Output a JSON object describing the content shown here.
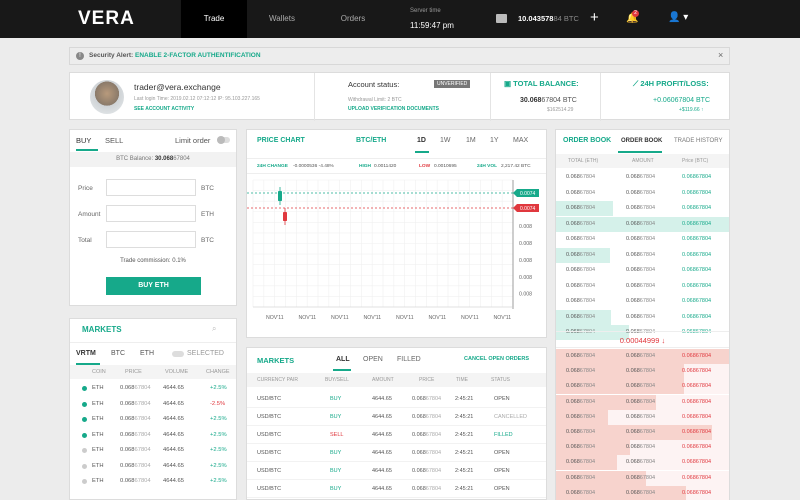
{
  "nav": {
    "logo": "VERA",
    "tabs": [
      "Trade",
      "Wallets",
      "Orders"
    ],
    "server_time_label": "Server time",
    "server_time": "11:59:47 pm",
    "balance_main": "10.043578",
    "balance_dim": "84 BTC",
    "notification_count": "2",
    "plus_glyph": "+"
  },
  "alert": {
    "label": "Security Alert:",
    "link": "ENABLE 2-FACTOR AUTHENTIFICATION",
    "close": "×"
  },
  "account": {
    "email": "trader@vera.exchange",
    "last_login": "Last login Time: 2019.02.12 07:12:12     IP: 95.103.227.165",
    "see_activity": "SEE ACCOUNT ACTIVITY",
    "status_label": "Account status:",
    "status_badge": "UNVERIFIED",
    "withdrawal": "Withdrawal Limit:   2 BTC",
    "upload": "UPLOAD VERIFICATION DOCUMENTS",
    "total_label": "TOTAL BALANCE:",
    "total_value": "30.068",
    "total_value_dim": "67804 BTC",
    "total_usd": "$162514.29",
    "pl_label": "24H PROFIT/LOSS:",
    "pl_value": "+0.06067804 BTC",
    "pl_usd": "+$119.66 ↑"
  },
  "buy_panel": {
    "tab_buy": "BUY",
    "tab_sell": "SELL",
    "limit_order": "Limit order",
    "balance_label": "BTC Balance:",
    "balance_value": "30.068",
    "balance_dim": "67804",
    "price_label": "Price",
    "price_unit": "BTC",
    "amount_label": "Amount",
    "amount_unit": "ETH",
    "total_label": "Total",
    "total_unit": "BTC",
    "commission": "Trade commission: 0.1%",
    "buy_button": "BUY ETH"
  },
  "markets_panel": {
    "title": "MARKETS",
    "filters": [
      "VRTM",
      "BTC",
      "ETH",
      "SELECTED"
    ],
    "headers": [
      "COIN",
      "PRICE",
      "VOLUME",
      "CHANGE"
    ],
    "rows": [
      {
        "coin": "ETH",
        "price": "0.068",
        "price_dim": "67804",
        "volume": "4644.65",
        "change": "+2.5%",
        "dir": "up",
        "fav": true
      },
      {
        "coin": "ETH",
        "price": "0.068",
        "price_dim": "67804",
        "volume": "4644.65",
        "change": "-2.5%",
        "dir": "down",
        "fav": true
      },
      {
        "coin": "ETH",
        "price": "0.068",
        "price_dim": "67804",
        "volume": "4644.65",
        "change": "+2.5%",
        "dir": "up",
        "fav": true
      },
      {
        "coin": "ETH",
        "price": "0.068",
        "price_dim": "67804",
        "volume": "4644.65",
        "change": "+2.5%",
        "dir": "up",
        "fav": true
      },
      {
        "coin": "ETH",
        "price": "0.068",
        "price_dim": "67804",
        "volume": "4644.65",
        "change": "+2.5%",
        "dir": "up",
        "fav": false
      },
      {
        "coin": "ETH",
        "price": "0.068",
        "price_dim": "67804",
        "volume": "4644.65",
        "change": "+2.5%",
        "dir": "up",
        "fav": false
      },
      {
        "coin": "ETH",
        "price": "0.068",
        "price_dim": "67804",
        "volume": "4644.65",
        "change": "+2.5%",
        "dir": "up",
        "fav": false
      }
    ]
  },
  "price_chart": {
    "title": "PRICE CHART",
    "pair": "BTC/ETH",
    "timeframes": [
      "1D",
      "1W",
      "1M",
      "1Y",
      "MAX"
    ],
    "stats": {
      "change_label": "24H CHANGE",
      "change_value": "-0.0000536 -4.48%",
      "high_label": "HIGH",
      "high_value": "0.0011420",
      "low_label": "LOW",
      "low_value": "0.0010695",
      "vol_label": "24H VOL",
      "vol_value": "2,217.42 BTC"
    }
  },
  "chart_data": {
    "type": "candlestick",
    "y_ticks": [
      "0.008",
      "0.008",
      "0.008",
      "0.008",
      "0.008",
      "0.008",
      "0.008"
    ],
    "x_ticks": [
      "NOV'11",
      "NOV'11",
      "NOV'11",
      "NOV'11",
      "NOV'11",
      "NOV'11",
      "NOV'11",
      "NOV'11"
    ],
    "markers": [
      {
        "label": "0.0074",
        "color": "#16a98a"
      },
      {
        "label": "0.0074",
        "color": "#e0383e"
      }
    ],
    "candles": [
      {
        "direction": "up",
        "color": "#16a98a"
      },
      {
        "direction": "down",
        "color": "#e0383e"
      }
    ]
  },
  "orders_panel": {
    "title": "MARKETS",
    "tabs": [
      "ALL",
      "OPEN",
      "FILLED"
    ],
    "cancel": "CANCEL OPEN ORDERS",
    "headers": [
      "CURRENCY PAIR",
      "BUY/SELL",
      "AMOUNT",
      "PRICE",
      "TIME",
      "STATUS"
    ],
    "rows": [
      {
        "pair": "USD/BTC",
        "side": "BUY",
        "amount": "4644.65",
        "price": "0.068",
        "price_dim": "67804",
        "time": "2:45:21",
        "status": "OPEN"
      },
      {
        "pair": "USD/BTC",
        "side": "BUY",
        "amount": "4644.65",
        "price": "0.068",
        "price_dim": "67804",
        "time": "2:45:21",
        "status": "CANCELLED"
      },
      {
        "pair": "USD/BTC",
        "side": "SELL",
        "amount": "4644.65",
        "price": "0.068",
        "price_dim": "67804",
        "time": "2:45:21",
        "status": "FILLED"
      },
      {
        "pair": "USD/BTC",
        "side": "BUY",
        "amount": "4644.65",
        "price": "0.068",
        "price_dim": "67804",
        "time": "2:45:21",
        "status": "OPEN"
      },
      {
        "pair": "USD/BTC",
        "side": "BUY",
        "amount": "4644.65",
        "price": "0.068",
        "price_dim": "67804",
        "time": "2:45:21",
        "status": "OPEN"
      },
      {
        "pair": "USD/BTC",
        "side": "BUY",
        "amount": "4644.65",
        "price": "0.068",
        "price_dim": "67804",
        "time": "2:45:21",
        "status": "OPEN"
      }
    ]
  },
  "order_book": {
    "title": "ORDER BOOK",
    "tab_book": "ORDER BOOK",
    "tab_history": "TRADE HISTORY",
    "headers": [
      "TOTAL (ETH)",
      "AMOUNT",
      "Price (BTC)"
    ],
    "mid_price": "0.00044999 ↓",
    "bids": [
      {
        "total": "0.068",
        "total_dim": "67804",
        "amount": "0.068",
        "amount_dim": "67804",
        "price": "0.068",
        "price_dim": "67804",
        "depth": 0.0
      },
      {
        "total": "0.068",
        "total_dim": "67804",
        "amount": "0.068",
        "amount_dim": "67804",
        "price": "0.068",
        "price_dim": "67804",
        "depth": 0.0
      },
      {
        "total": "0.068",
        "total_dim": "67804",
        "amount": "0.068",
        "amount_dim": "67804",
        "price": "0.068",
        "price_dim": "67804",
        "depth": 0.33
      },
      {
        "total": "0.068",
        "total_dim": "67804",
        "amount": "0.068",
        "amount_dim": "67804",
        "price": "0.068",
        "price_dim": "67804",
        "depth": 1.0
      },
      {
        "total": "0.068",
        "total_dim": "67804",
        "amount": "0.068",
        "amount_dim": "67804",
        "price": "0.068",
        "price_dim": "67804",
        "depth": 0.0
      },
      {
        "total": "0.068",
        "total_dim": "67804",
        "amount": "0.068",
        "amount_dim": "67804",
        "price": "0.068",
        "price_dim": "67804",
        "depth": 0.31
      },
      {
        "total": "0.068",
        "total_dim": "67804",
        "amount": "0.068",
        "amount_dim": "67804",
        "price": "0.068",
        "price_dim": "67804",
        "depth": 0.0
      },
      {
        "total": "0.068",
        "total_dim": "67804",
        "amount": "0.068",
        "amount_dim": "67804",
        "price": "0.068",
        "price_dim": "67804",
        "depth": 0.0
      },
      {
        "total": "0.068",
        "total_dim": "67804",
        "amount": "0.068",
        "amount_dim": "67804",
        "price": "0.068",
        "price_dim": "67804",
        "depth": 0.0
      },
      {
        "total": "0.068",
        "total_dim": "67804",
        "amount": "0.068",
        "amount_dim": "67804",
        "price": "0.068",
        "price_dim": "67804",
        "depth": 0.32
      },
      {
        "total": "0.068",
        "total_dim": "67804",
        "amount": "0.068",
        "amount_dim": "67804",
        "price": "0.068",
        "price_dim": "67804",
        "depth": 0.42
      }
    ],
    "asks": [
      {
        "total": "0.068",
        "total_dim": "67804",
        "amount": "0.068",
        "amount_dim": "67804",
        "price": "0.068",
        "price_dim": "67804",
        "depth": 1.0
      },
      {
        "total": "0.068",
        "total_dim": "67804",
        "amount": "0.068",
        "amount_dim": "67804",
        "price": "0.068",
        "price_dim": "67804",
        "depth": 0.74
      },
      {
        "total": "0.068",
        "total_dim": "67804",
        "amount": "0.068",
        "amount_dim": "67804",
        "price": "0.068",
        "price_dim": "67804",
        "depth": 0.74
      },
      {
        "total": "0.068",
        "total_dim": "67804",
        "amount": "0.068",
        "amount_dim": "67804",
        "price": "0.068",
        "price_dim": "67804",
        "depth": 0.58
      },
      {
        "total": "0.068",
        "total_dim": "67804",
        "amount": "0.068",
        "amount_dim": "67804",
        "price": "0.068",
        "price_dim": "67804",
        "depth": 0.3
      },
      {
        "total": "0.068",
        "total_dim": "67804",
        "amount": "0.068",
        "amount_dim": "67804",
        "price": "0.068",
        "price_dim": "67804",
        "depth": 0.9
      },
      {
        "total": "0.068",
        "total_dim": "67804",
        "amount": "0.068",
        "amount_dim": "67804",
        "price": "0.068",
        "price_dim": "67804",
        "depth": 0.43
      },
      {
        "total": "0.068",
        "total_dim": "67804",
        "amount": "0.068",
        "amount_dim": "67804",
        "price": "0.068",
        "price_dim": "67804",
        "depth": 0.35
      },
      {
        "total": "0.068",
        "total_dim": "67804",
        "amount": "0.068",
        "amount_dim": "67804",
        "price": "0.068",
        "price_dim": "67804",
        "depth": 0.52
      },
      {
        "total": "0.068",
        "total_dim": "67804",
        "amount": "0.068",
        "amount_dim": "67804",
        "price": "0.068",
        "price_dim": "67804",
        "depth": 0.75
      }
    ]
  },
  "colors": {
    "accent": "#16a98a",
    "down": "#e0383e",
    "nav_bg": "#181818"
  }
}
